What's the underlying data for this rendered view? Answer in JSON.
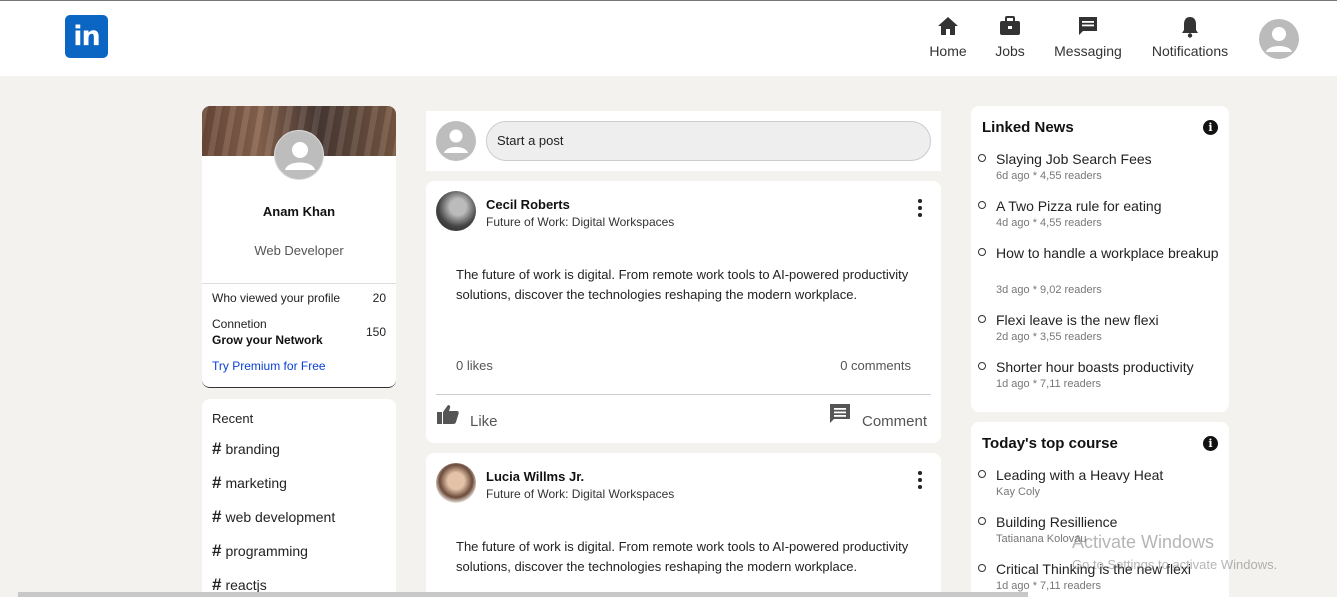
{
  "header": {
    "logo_text": "in",
    "nav": {
      "home": "Home",
      "jobs": "Jobs",
      "messaging": "Messaging",
      "notifications": "Notifications"
    },
    "brand_color": "#0a66c2"
  },
  "profile": {
    "name": "Anam Khan",
    "title": "Web Developer",
    "viewed_label": "Who viewed your profile",
    "viewed_count": "20",
    "connection_label": "Connetion",
    "grow_label": "Grow your Network",
    "connection_count": "150",
    "premium_label": "Try Premium for Free"
  },
  "recent": {
    "title": "Recent",
    "tags": [
      "branding",
      "marketing",
      "web development",
      "programming",
      "reactjs"
    ]
  },
  "composer": {
    "placeholder": "Start a post"
  },
  "posts": [
    {
      "author": "Cecil Roberts",
      "subtitle": "Future of Work: Digital Workspaces",
      "text": "The future of work is digital. From remote work tools to AI-powered productivity solutions, discover the technologies reshaping the modern workplace.",
      "likes": "0 likes",
      "comments": "0 comments",
      "like_label": "Like",
      "comment_label": "Comment"
    },
    {
      "author": "Lucia Willms Jr.",
      "subtitle": "Future of Work: Digital Workspaces",
      "text": "The future of work is digital. From remote work tools to AI-powered productivity solutions, discover the technologies reshaping the modern workplace."
    }
  ],
  "news": {
    "title": "Linked News",
    "items": [
      {
        "title": "Slaying Job Search Fees",
        "meta": "6d ago * 4,55 readers"
      },
      {
        "title": "A Two Pizza rule for eating",
        "meta": "4d ago * 4,55 readers"
      },
      {
        "title": "How to handle a workplace breakup",
        "meta": "3d ago * 9,02 readers"
      },
      {
        "title": "Flexi leave is the new flexi",
        "meta": "2d ago * 3,55 readers"
      },
      {
        "title": "Shorter hour boasts productivity",
        "meta": "1d ago * 7,11 readers"
      }
    ]
  },
  "courses": {
    "title": "Today's top course",
    "items": [
      {
        "title": "Leading with a Heavy Heat",
        "meta": "Kay Coly"
      },
      {
        "title": "Building Resillience",
        "meta": "Tatianana Kolovau"
      },
      {
        "title": "Critical Thinking is the new flexi",
        "meta": "1d ago * 7,11 readers"
      }
    ]
  },
  "watermark": {
    "line1": "Activate Windows",
    "line2": "Go to Settings to activate Windows."
  }
}
